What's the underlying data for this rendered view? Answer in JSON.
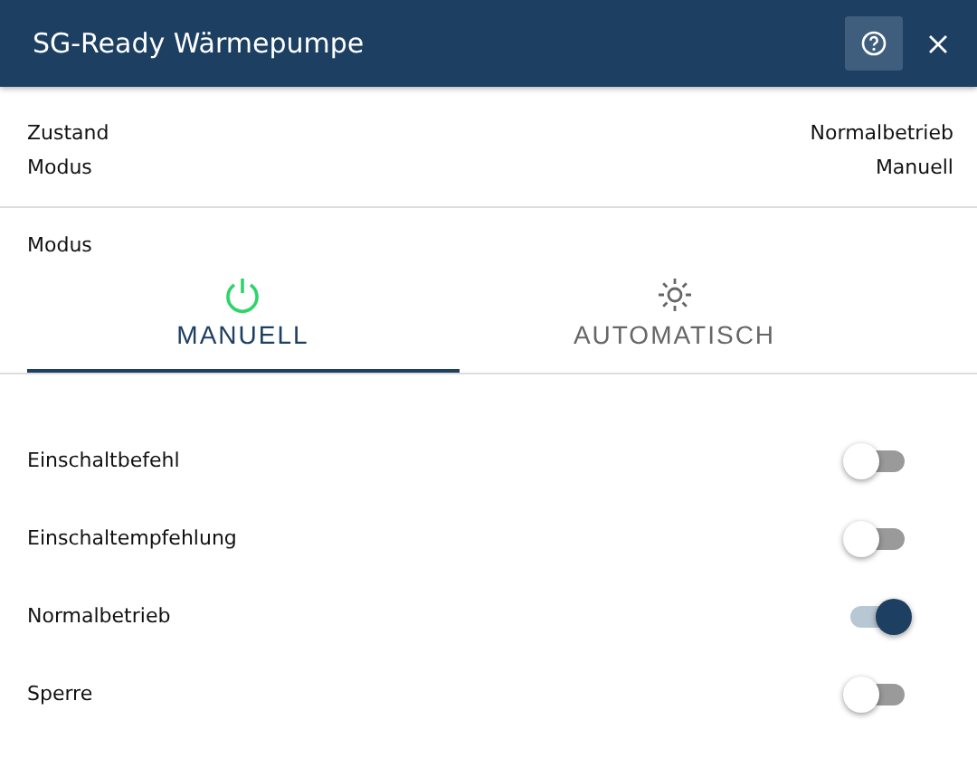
{
  "window": {
    "title": "SG-Ready Wärmepumpe"
  },
  "info": [
    {
      "label": "Zustand",
      "value": "Normalbetrieb"
    },
    {
      "label": "Modus",
      "value": "Manuell"
    }
  ],
  "mode": {
    "label": "Modus",
    "tabs": [
      {
        "label": "MANUELL",
        "kind": "power",
        "selected": true
      },
      {
        "label": "AUTOMATISCH",
        "kind": "sun",
        "selected": false
      }
    ]
  },
  "switches": [
    {
      "label": "Einschaltbefehl",
      "on": false
    },
    {
      "label": "Einschaltempfehlung",
      "on": false
    },
    {
      "label": "Normalbetrieb",
      "on": true
    },
    {
      "label": "Sperre",
      "on": false
    }
  ]
}
